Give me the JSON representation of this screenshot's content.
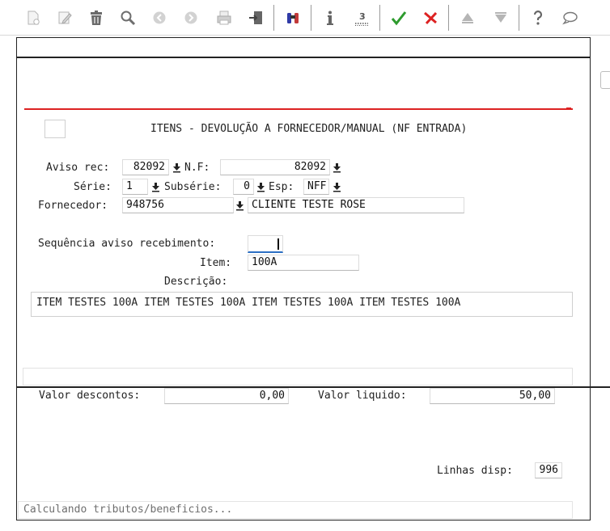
{
  "toolbar": {
    "buttons": [
      {
        "name": "new-document-icon"
      },
      {
        "name": "edit-icon"
      },
      {
        "name": "trash-icon"
      },
      {
        "name": "search-icon"
      },
      {
        "name": "previous-icon"
      },
      {
        "name": "next-icon"
      },
      {
        "name": "print-icon"
      },
      {
        "name": "exit-icon"
      },
      {
        "name": "binoculars-icon"
      },
      {
        "name": "info-icon"
      },
      {
        "name": "list-icon"
      },
      {
        "name": "confirm-check-icon"
      },
      {
        "name": "cancel-x-icon"
      },
      {
        "name": "scroll-up-icon"
      },
      {
        "name": "scroll-down-icon"
      },
      {
        "name": "help-icon"
      },
      {
        "name": "comment-icon"
      }
    ]
  },
  "form": {
    "title": "ITENS - DEVOLUÇÃO A FORNECEDOR/MANUAL (NF ENTRADA)",
    "aviso_rec_label": "Aviso rec:",
    "aviso_rec_value": "82092",
    "nf_label": "N.F:",
    "nf_value": "82092",
    "serie_label": "Série:",
    "serie_value": "1",
    "subserie_label": "Subsérie:",
    "subserie_value": "0",
    "esp_label": "Esp:",
    "esp_value": "NFF",
    "fornecedor_label": "Fornecedor:",
    "fornecedor_code": "948756",
    "fornecedor_name": "CLIENTE TESTE ROSE",
    "sequencia_label": "Sequência aviso recebimento:",
    "sequencia_value": "",
    "item_label": "Item:",
    "item_value": "100A",
    "descricao_label": "Descrição:",
    "descricao_value": "ITEM TESTES 100A ITEM TESTES 100A ITEM TESTES 100A ITEM TESTES 100A"
  },
  "totals": {
    "valor_descontos_label": "Valor descontos:",
    "valor_descontos_value": "0,00",
    "valor_liquido_label": "Valor liquido:",
    "valor_liquido_value": "50,00",
    "linhas_disp_label": "Linhas disp:",
    "linhas_disp_value": "996"
  },
  "status": {
    "message": "Calculando tributos/beneficios..."
  },
  "colors": {
    "accent_red": "#d22222",
    "confirm_green": "#2e9b2e",
    "focus_blue": "#2b6fc4"
  }
}
